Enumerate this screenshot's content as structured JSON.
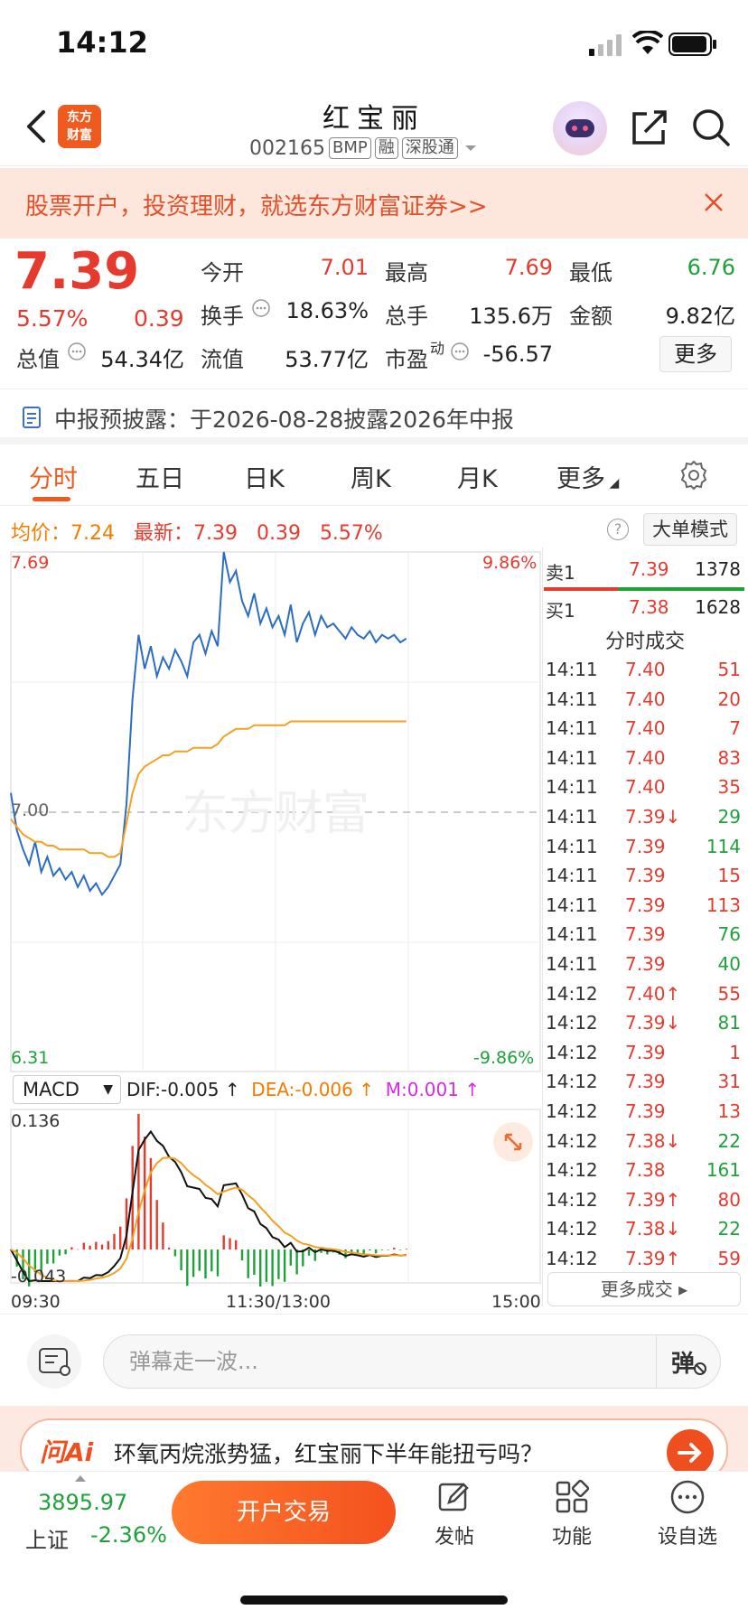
{
  "status_bar": {
    "time": "14:12"
  },
  "header": {
    "logo_text": "东方\n财富",
    "stock_name": "红宝丽",
    "stock_code": "002165",
    "tags": [
      "BMP",
      "融",
      "深股通"
    ]
  },
  "promo": {
    "text": "股票开户，投资理财，就选东方财富证券>>"
  },
  "quote": {
    "price": "7.39",
    "change_pct": "5.57%",
    "change_amt": "0.39",
    "fields": {
      "open_label": "今开",
      "open": "7.01",
      "high_label": "最高",
      "high": "7.69",
      "low_label": "最低",
      "low": "6.76",
      "turnover_label": "换手",
      "turnover": "18.63%",
      "volume_label": "总手",
      "volume": "135.6万",
      "amount_label": "金额",
      "amount": "9.82亿",
      "mktcap_label": "总值",
      "mktcap": "54.34亿",
      "float_label": "流值",
      "float": "53.77亿",
      "pe_label": "市盈",
      "pe_sup": "动",
      "pe": "-56.57"
    },
    "more_label": "更多"
  },
  "announcement": {
    "text": "中报预披露：于2026-08-28披露2026年中报"
  },
  "tabs": [
    "分时",
    "五日",
    "日K",
    "周K",
    "月K",
    "更多"
  ],
  "info_row": {
    "avg_label": "均价：",
    "avg": "7.24",
    "latest_label": "最新：",
    "latest": "7.39",
    "chg": "0.39",
    "pct": "5.57%",
    "help": "?",
    "big_order_label": "大单模式"
  },
  "chart": {
    "y_top": "7.69",
    "y_mid": "7.00",
    "y_bot": "6.31",
    "pct_top": "9.86%",
    "pct_bot": "-9.86%",
    "x_start": "09:30",
    "x_mid": "11:30/13:00",
    "x_end": "15:00",
    "watermark": "东方财富",
    "macd": {
      "select_label": "MACD",
      "dif": "DIF:-0.005 ↑",
      "dea": "DEA:-0.006 ↑",
      "m": "M:0.001 ↑",
      "y_top": "0.136",
      "y_bot": "-0.043"
    }
  },
  "chart_data": {
    "type": "line",
    "title": "",
    "ylim": [
      6.31,
      7.69
    ],
    "prev_close": 7.0,
    "series": [
      {
        "name": "",
        "color": "#2b6cc4",
        "values": [
          7.05,
          6.95,
          6.9,
          6.86,
          6.92,
          6.84,
          6.88,
          6.83,
          6.85,
          6.82,
          6.84,
          6.8,
          6.83,
          6.79,
          6.81,
          6.78,
          6.8,
          6.83,
          6.86,
          7.02,
          7.3,
          7.47,
          7.38,
          7.44,
          7.36,
          7.41,
          7.38,
          7.43,
          7.4,
          7.36,
          7.45,
          7.47,
          7.42,
          7.48,
          7.44,
          7.69,
          7.61,
          7.64,
          7.56,
          7.52,
          7.58,
          7.5,
          7.54,
          7.49,
          7.52,
          7.47,
          7.55,
          7.45,
          7.5,
          7.53,
          7.47,
          7.52,
          7.49,
          7.5,
          7.48,
          7.46,
          7.49,
          7.47,
          7.46,
          7.48,
          7.45,
          7.47,
          7.46,
          7.47,
          7.45,
          7.46
        ]
      },
      {
        "name": "",
        "color": "#f5a020",
        "values": [
          6.98,
          6.96,
          6.94,
          6.93,
          6.92,
          6.92,
          6.91,
          6.91,
          6.9,
          6.9,
          6.9,
          6.9,
          6.9,
          6.89,
          6.89,
          6.89,
          6.88,
          6.88,
          6.89,
          6.97,
          7.05,
          7.1,
          7.12,
          7.13,
          7.14,
          7.15,
          7.15,
          7.16,
          7.16,
          7.16,
          7.17,
          7.17,
          7.17,
          7.17,
          7.18,
          7.2,
          7.21,
          7.22,
          7.22,
          7.22,
          7.23,
          7.23,
          7.23,
          7.23,
          7.23,
          7.23,
          7.24,
          7.24,
          7.24,
          7.24,
          7.24,
          7.24,
          7.24,
          7.24,
          7.24,
          7.24,
          7.24,
          7.24,
          7.24,
          7.24,
          7.24,
          7.24,
          7.24,
          7.24,
          7.24,
          7.24
        ]
      }
    ]
  },
  "order_book": {
    "sell": {
      "label": "卖1",
      "price": "7.39",
      "vol": "1378"
    },
    "buy": {
      "label": "买1",
      "price": "7.38",
      "vol": "1628"
    }
  },
  "trades_title": "分时成交",
  "trades": [
    [
      "14:11",
      "7.40",
      "51",
      "r",
      "r"
    ],
    [
      "14:11",
      "7.40",
      "20",
      "r",
      "r"
    ],
    [
      "14:11",
      "7.40",
      "7",
      "r",
      "r"
    ],
    [
      "14:11",
      "7.40",
      "83",
      "r",
      "r"
    ],
    [
      "14:11",
      "7.40",
      "35",
      "r",
      "r"
    ],
    [
      "14:11",
      "7.39↓",
      "29",
      "r",
      "g"
    ],
    [
      "14:11",
      "7.39",
      "114",
      "r",
      "g"
    ],
    [
      "14:11",
      "7.39",
      "15",
      "r",
      "r"
    ],
    [
      "14:11",
      "7.39",
      "113",
      "r",
      "r"
    ],
    [
      "14:11",
      "7.39",
      "76",
      "r",
      "g"
    ],
    [
      "14:11",
      "7.39",
      "40",
      "r",
      "g"
    ],
    [
      "14:12",
      "7.40↑",
      "55",
      "r",
      "r"
    ],
    [
      "14:12",
      "7.39↓",
      "81",
      "r",
      "g"
    ],
    [
      "14:12",
      "7.39",
      "1",
      "r",
      "r"
    ],
    [
      "14:12",
      "7.39",
      "31",
      "r",
      "r"
    ],
    [
      "14:12",
      "7.39",
      "13",
      "r",
      "r"
    ],
    [
      "14:12",
      "7.38↓",
      "22",
      "r",
      "g"
    ],
    [
      "14:12",
      "7.38",
      "161",
      "r",
      "g"
    ],
    [
      "14:12",
      "7.39↑",
      "80",
      "r",
      "r"
    ],
    [
      "14:12",
      "7.38↓",
      "22",
      "r",
      "g"
    ],
    [
      "14:12",
      "7.39↑",
      "59",
      "r",
      "r"
    ]
  ],
  "more_trades_label": "更多成交 ▸",
  "comment": {
    "placeholder": "弹幕走一波...",
    "danmu": "弹"
  },
  "ai": {
    "logo": "问Ai",
    "question": "环氧丙烷涨势猛，红宝丽下半年能扭亏吗？"
  },
  "bottom": {
    "index_value": "3895.97",
    "index_name": "上证",
    "index_change": "-2.36%",
    "open_trade": "开户交易",
    "post": "发帖",
    "functions": "功能",
    "watchlist": "设自选"
  },
  "colors": {
    "up": "#e63a2e",
    "down": "#1fa13a",
    "accent": "#f05a1e"
  }
}
